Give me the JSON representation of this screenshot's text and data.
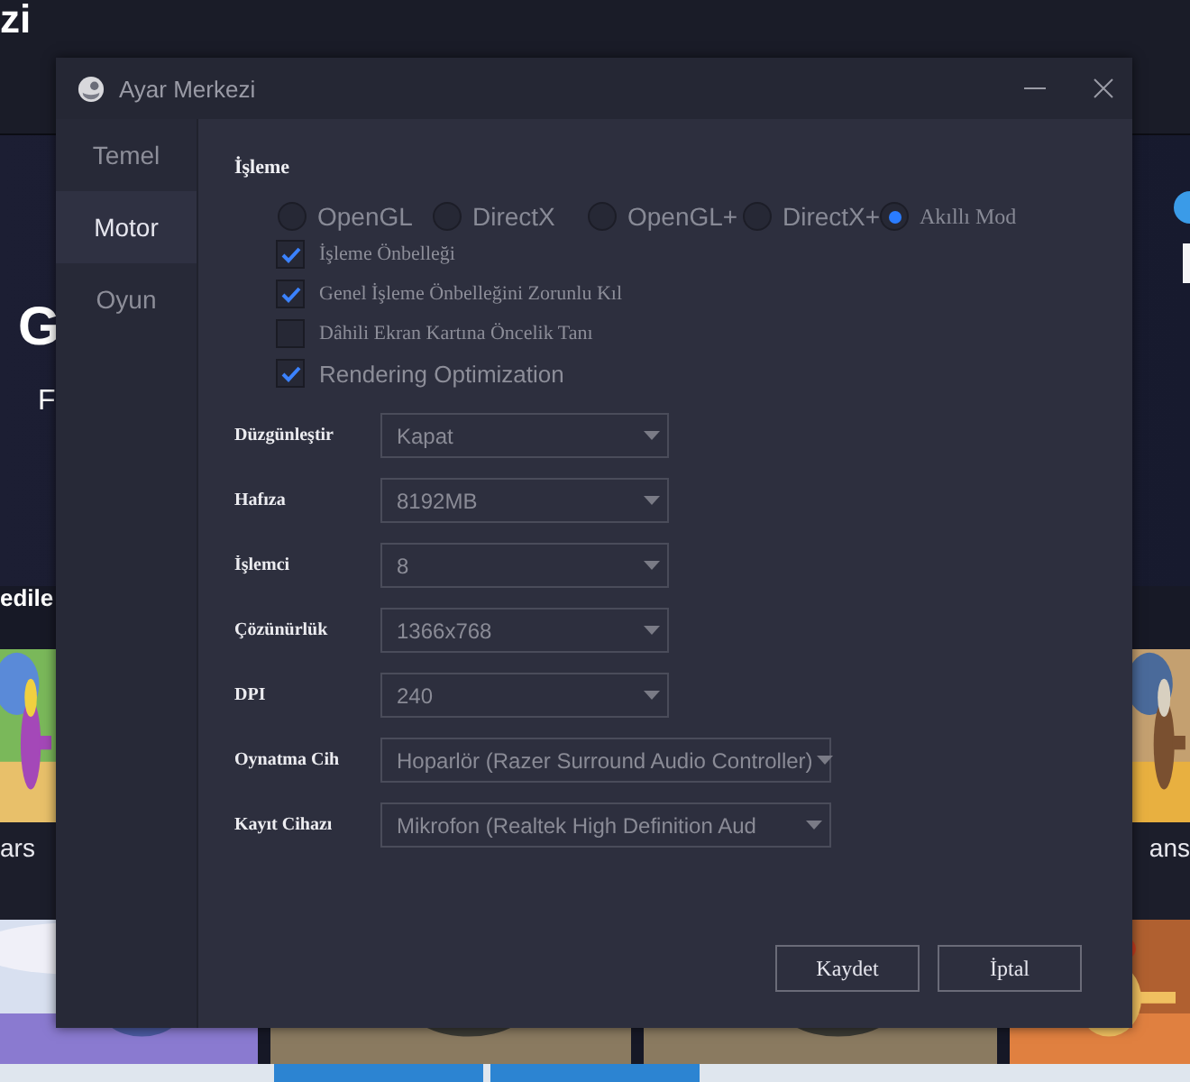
{
  "background": {
    "header_text": "zi",
    "hero_texts": [
      "G",
      "F"
    ],
    "section_title": "edile",
    "captions": [
      "ars",
      "ans"
    ]
  },
  "window": {
    "title": "Ayar Merkezi"
  },
  "sidebar": {
    "items": [
      {
        "label": "Temel",
        "selected": false
      },
      {
        "label": "Motor",
        "selected": true
      },
      {
        "label": "Oyun",
        "selected": false
      }
    ]
  },
  "rendering": {
    "title": "İşleme",
    "modes": [
      {
        "label": "OpenGL",
        "selected": false
      },
      {
        "label": "DirectX",
        "selected": false
      },
      {
        "label": "OpenGL+",
        "selected": false
      },
      {
        "label": "DirectX+",
        "selected": false
      },
      {
        "label": "Akıllı Mod",
        "selected": true
      }
    ],
    "options": [
      {
        "label": "İşleme Önbelleği",
        "checked": true
      },
      {
        "label": "Genel İşleme Önbelleğini Zorunlu Kıl",
        "checked": true
      },
      {
        "label": "Dâhili Ekran Kartına Öncelik Tanı",
        "checked": false
      },
      {
        "label": "Rendering Optimization",
        "checked": true
      }
    ]
  },
  "settings": [
    {
      "label": "Düzgünleştir",
      "value": "Kapat",
      "wide": false
    },
    {
      "label": "Hafıza",
      "value": "8192MB",
      "wide": false
    },
    {
      "label": "İşlemci",
      "value": "8",
      "wide": false
    },
    {
      "label": "Çözünürlük",
      "value": "1366x768",
      "wide": false
    },
    {
      "label": "DPI",
      "value": "240",
      "wide": false
    },
    {
      "label": "Oynatma Cih",
      "value": "Hoparlör (Razer Surround Audio Controller)",
      "wide": true
    },
    {
      "label": "Kayıt Cihazı",
      "value": "Mikrofon (Realtek High Definition Aud",
      "wide": true
    }
  ],
  "buttons": [
    {
      "label": "Kaydet"
    },
    {
      "label": "İptal"
    }
  ]
}
